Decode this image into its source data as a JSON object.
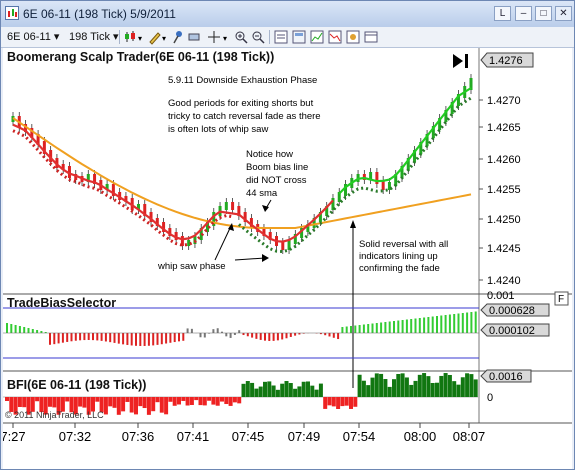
{
  "window": {
    "title": "6E 06-11 (198 Tick)  5/9/2011",
    "btn_restore": "L",
    "btn_min": "–",
    "btn_max": "□",
    "btn_close": "✕"
  },
  "toolbar": {
    "instrument": "6E 06-11",
    "period": "198 Tick"
  },
  "price_panel": {
    "title": "Boomerang Scalp Trader(6E 06-11 (198 Tick))",
    "last_price": "1.4276",
    "axis_ticks": [
      "1.4270",
      "1.4265",
      "1.4260",
      "1.4255",
      "1.4250",
      "1.4245",
      "1.4240"
    ],
    "notes": {
      "heading": "5.9.11   Downside Exhaustion Phase",
      "line1": "Good periods for exiting shorts but",
      "line2": "tricky to catch reversal fade as there",
      "line3": "is often lots of whip saw",
      "boom1": "Notice how",
      "boom2": "Boom bias line",
      "boom3": "did NOT cross",
      "boom4": "44 sma",
      "whip": "whip saw phase",
      "rev1": "Solid reversal with all",
      "rev2": "indicators lining up",
      "rev3": "confirming the fade"
    }
  },
  "bias_panel": {
    "title": "TradeBiasSelector",
    "top_tick": "0.001",
    "value_a": "0.000628",
    "value_b": "0.000102",
    "flag": "F"
  },
  "bfi_panel": {
    "title": "BFI(6E 06-11 (198 Tick))",
    "value": "0.0016",
    "zero_tick": "0",
    "copyright": "© 2011 NinjaTrader, LLC"
  },
  "x_axis": [
    "7:27",
    "07:32",
    "07:36",
    "07:41",
    "07:45",
    "07:49",
    "07:54",
    "08:00",
    "08:07"
  ],
  "colors": {
    "up_candle": "#22aa22",
    "down_candle": "#dd2222",
    "sma": "#f0a020",
    "boom_line": "#e03030",
    "green_line": "#22cc22",
    "dotted_red": "#cc2222",
    "dotted_green": "#2a7a2a"
  }
}
